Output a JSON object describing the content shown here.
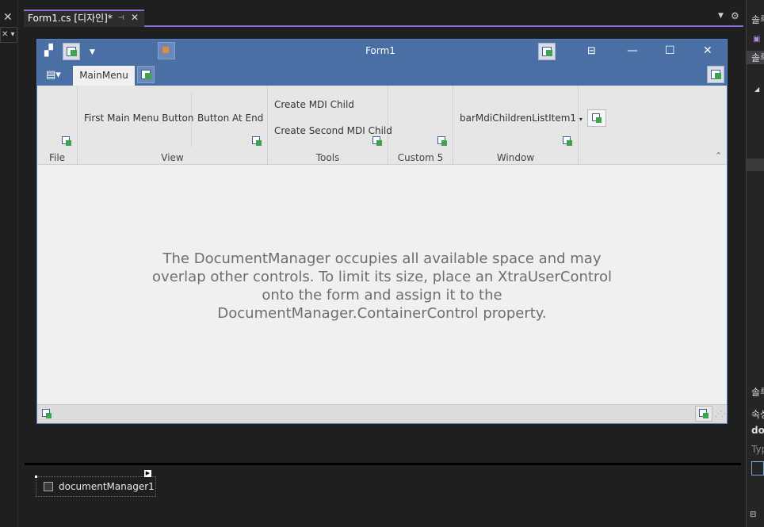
{
  "editor": {
    "tab_label": "Form1.cs [디자인]*",
    "pin_glyph": "⊣",
    "close_glyph": "✕"
  },
  "right_panel": {
    "labels": [
      "솔루",
      "솔루",
      "솔루",
      "속성",
      "doc",
      "Typ"
    ]
  },
  "form": {
    "title": "Form1",
    "tabs": [
      {
        "label": "MainMenu"
      }
    ],
    "groups": [
      {
        "caption": "File"
      },
      {
        "caption": "View",
        "buttons": [
          "First Main Menu Button",
          "Button At End"
        ]
      },
      {
        "caption": "Tools",
        "buttons": [
          "Create MDI Child",
          "Create Second MDI Child"
        ]
      },
      {
        "caption": "Custom 5"
      },
      {
        "caption": "Window",
        "buttons": [
          "barMdiChildrenListItem1"
        ]
      }
    ],
    "message": "The DocumentManager occupies all available space and may overlap other controls. To limit its size, place an XtraUserControl onto the form and assign it to the DocumentManager.ContainerControl property."
  },
  "tray": {
    "component": "documentManager1"
  },
  "colors": {
    "accent": "#8c6ad8",
    "titlebar": "#4a6fa5"
  }
}
